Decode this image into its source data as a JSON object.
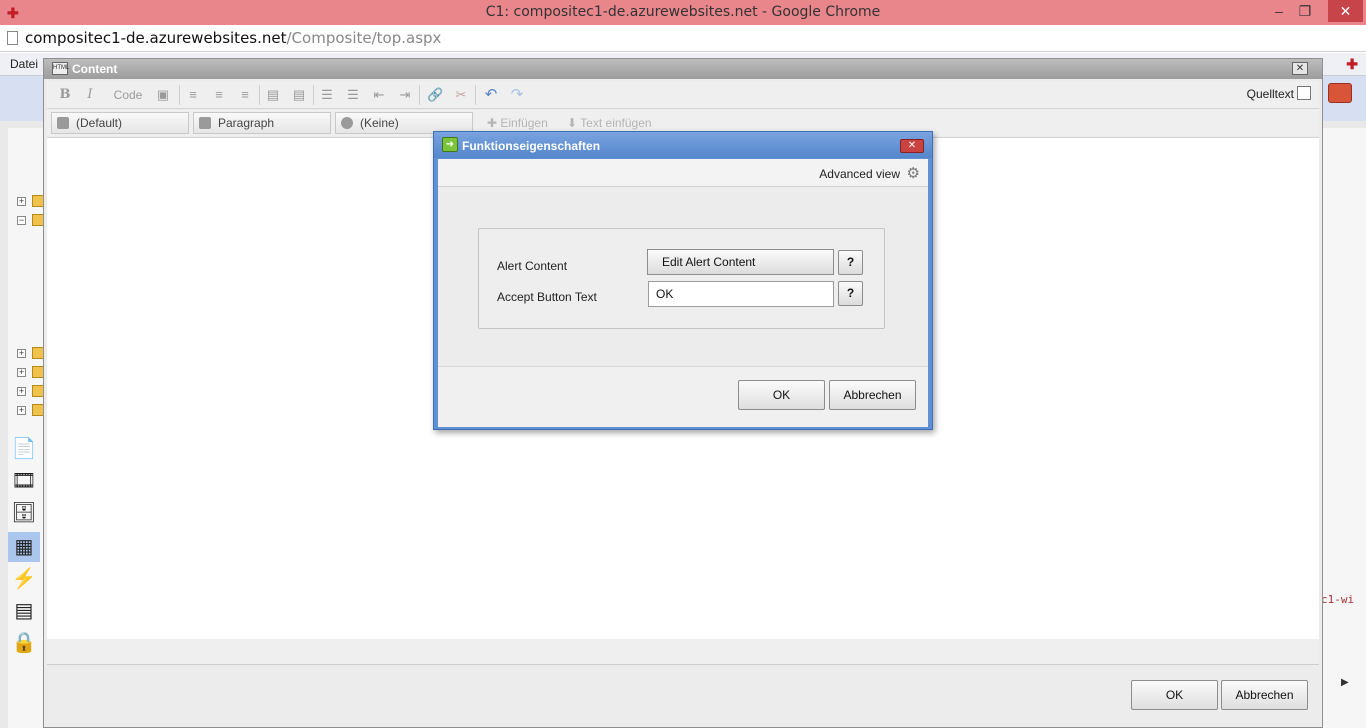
{
  "browser": {
    "window_title": "C1: compositec1-de.azurewebsites.net - Google Chrome",
    "minimize_glyph": "–",
    "restore_glyph": "❐",
    "close_glyph": "✕",
    "url_host": "compositec1-de.azurewebsites.net",
    "url_path": "/Composite/top.aspx"
  },
  "cms": {
    "menu_datei": "Datei",
    "code_snippet": "c1-wi"
  },
  "content_dialog": {
    "title": "Content",
    "icon_text": "HTML",
    "toolbar": {
      "bold": "B",
      "italic": "I",
      "code": "Code",
      "quelltext": "Quelltext"
    },
    "format": {
      "style_select": "(Default)",
      "paragraph_select": "Paragraph",
      "class_select": "(Keine)",
      "einfuegen": "Einfügen",
      "text_einfuegen": "Text einfügen"
    },
    "ok_label": "OK",
    "cancel_label": "Abbrechen"
  },
  "function_dialog": {
    "title": "Funktionseigenschaften",
    "advanced_view": "Advanced view",
    "params": [
      {
        "label": "Alert Content",
        "button_label": "Edit Alert Content"
      },
      {
        "label": "Accept Button Text",
        "value": "OK"
      }
    ],
    "help_label": "?",
    "ok_label": "OK",
    "cancel_label": "Abbrechen"
  },
  "colors": {
    "chrome_titlebar": "#e8868c",
    "dialog_border": "#5f8fd4",
    "cms_ribbon": "#d6e0f2"
  }
}
